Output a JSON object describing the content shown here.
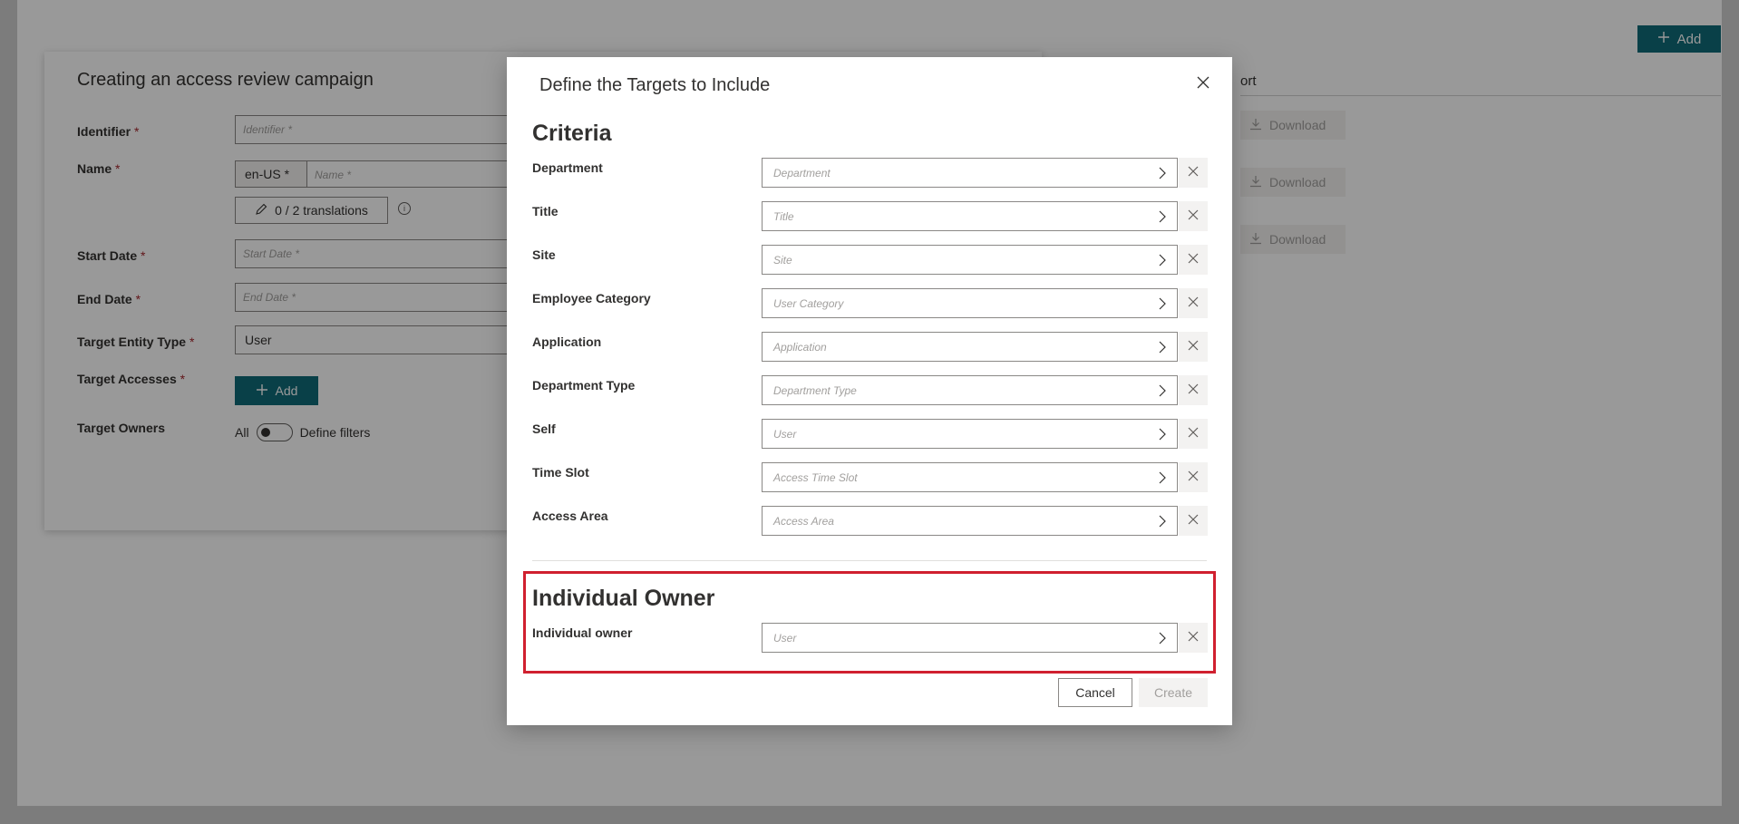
{
  "background": {
    "add_label": "Add",
    "column_header": "ort",
    "download_labels": [
      "Download",
      "Download",
      "Download"
    ]
  },
  "campaign": {
    "title": "Creating an access review campaign",
    "required_mark": "*",
    "identifier_label": "Identifier",
    "identifier_placeholder": "Identifier *",
    "name_label": "Name",
    "language": "en-US *",
    "name_placeholder": "Name *",
    "translations_label": "0 / 2 translations",
    "start_date_label": "Start Date",
    "start_date_placeholder": "Start Date *",
    "end_date_label": "End Date",
    "end_date_placeholder": "End Date *",
    "target_entity_type_label": "Target Entity Type",
    "target_entity_type_value": "User",
    "target_accesses_label": "Target Accesses",
    "add_label": "Add",
    "target_owners_label": "Target Owners",
    "toggle_off_label": "All",
    "toggle_on_label": "Define filters"
  },
  "dialog": {
    "title": "Define the Targets to Include",
    "criteria_title": "Criteria",
    "criteria": [
      {
        "label": "Department",
        "placeholder": "Department"
      },
      {
        "label": "Title",
        "placeholder": "Title"
      },
      {
        "label": "Site",
        "placeholder": "Site"
      },
      {
        "label": "Employee Category",
        "placeholder": "User Category"
      },
      {
        "label": "Application",
        "placeholder": "Application"
      },
      {
        "label": "Department Type",
        "placeholder": "Department Type"
      },
      {
        "label": "Self",
        "placeholder": "User"
      },
      {
        "label": "Time Slot",
        "placeholder": "Access Time Slot"
      },
      {
        "label": "Access Area",
        "placeholder": "Access Area"
      }
    ],
    "owner_section_title": "Individual Owner",
    "owner_label": "Individual owner",
    "owner_placeholder": "User",
    "cancel_label": "Cancel",
    "create_label": "Create"
  },
  "colors": {
    "accent": "#0f6b78",
    "highlight": "#d0202f",
    "required": "#a4262c"
  }
}
